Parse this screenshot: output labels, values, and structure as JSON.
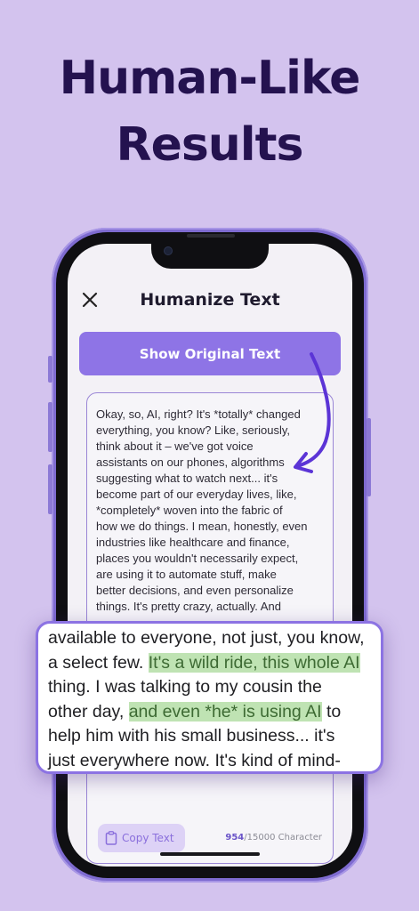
{
  "headline": {
    "line1": "Human-Like",
    "line2": "Results"
  },
  "screen": {
    "title": "Humanize Text",
    "show_original_label": "Show Original Text",
    "original_lines": [
      "Okay, so, AI, right?  It's *totally* changed",
      "everything, you know?  Like, seriously,",
      "think about it – we've got voice",
      "assistants on our phones,  algorithms",
      "suggesting what to watch next... it's",
      "become part of our everyday lives,  like,",
      "*completely* woven into the fabric of",
      "how we do things.  I mean, honestly, even",
      "industries like healthcare and finance,",
      "places you wouldn't necessarily expect,",
      "are using it to automate stuff, make",
      "better decisions, and even personalize",
      "things.  It's pretty crazy, actually.  And"
    ],
    "copy_label": "Copy Text",
    "char_used": "954",
    "char_limit": "/15000 Character"
  },
  "zoom": {
    "line1": "available to everyone, not just, you know,",
    "line2_a": "a select few.  ",
    "line2_hl": "It's a wild ride, this whole AI",
    "line3": "thing. I was talking to my cousin the",
    "line4_a": "other day, ",
    "line4_hl": "and even *he* is using AI",
    "line4_b": " to",
    "line5": "help him with his small business... it's",
    "line6": "just everywhere now.  It's kind of mind-"
  },
  "colors": {
    "background": "#d3c3ee",
    "headline": "#24124f",
    "accent": "#8e74e6",
    "highlight": "#bfe3b3"
  },
  "icons": [
    "close-icon",
    "clipboard-icon",
    "curved-arrow-icon"
  ]
}
